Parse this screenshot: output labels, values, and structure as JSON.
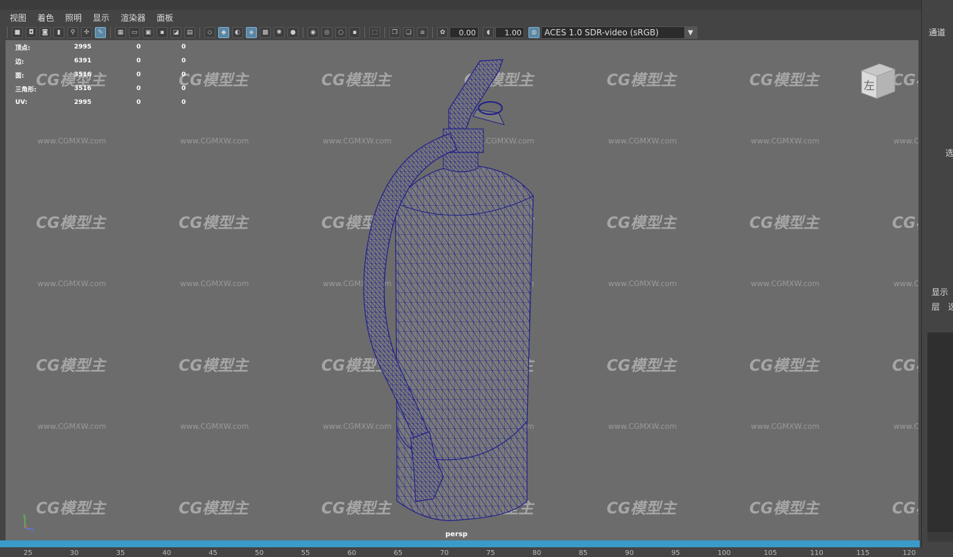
{
  "menu": [
    "视图",
    "着色",
    "照明",
    "显示",
    "渲染器",
    "面板"
  ],
  "toolbar": {
    "exposure": "0.00",
    "gamma": "1.00",
    "colorspace": "ACES 1.0 SDR-video (sRGB)"
  },
  "hud": [
    {
      "label": "顶点:",
      "v1": "2995",
      "v2": "0",
      "v3": "0"
    },
    {
      "label": "边:",
      "v1": "6391",
      "v2": "0",
      "v3": "0"
    },
    {
      "label": "面:",
      "v1": "3516",
      "v2": "0",
      "v3": "0"
    },
    {
      "label": "三角形:",
      "v1": "3516",
      "v2": "0",
      "v3": "0"
    },
    {
      "label": "UV:",
      "v1": "2995",
      "v2": "0",
      "v3": "0"
    }
  ],
  "viewcube": {
    "face": "左"
  },
  "camera_label": "persp",
  "watermark": {
    "logo": "CG模型主",
    "url": "www.CGMXW.com"
  },
  "right_panel": {
    "channels": "通道",
    "select": "选",
    "display": "显示",
    "layer": "层",
    "layer2": "选"
  },
  "ruler": [
    "25",
    "30",
    "35",
    "40",
    "45",
    "50",
    "55",
    "60",
    "65",
    "70",
    "75",
    "80",
    "85",
    "90",
    "95",
    "100",
    "105",
    "110",
    "115",
    "120"
  ],
  "colors": {
    "viewport_bg": "#6c6c6c",
    "wire": "#1c1c8c",
    "timeline": "#3a9ac8"
  }
}
